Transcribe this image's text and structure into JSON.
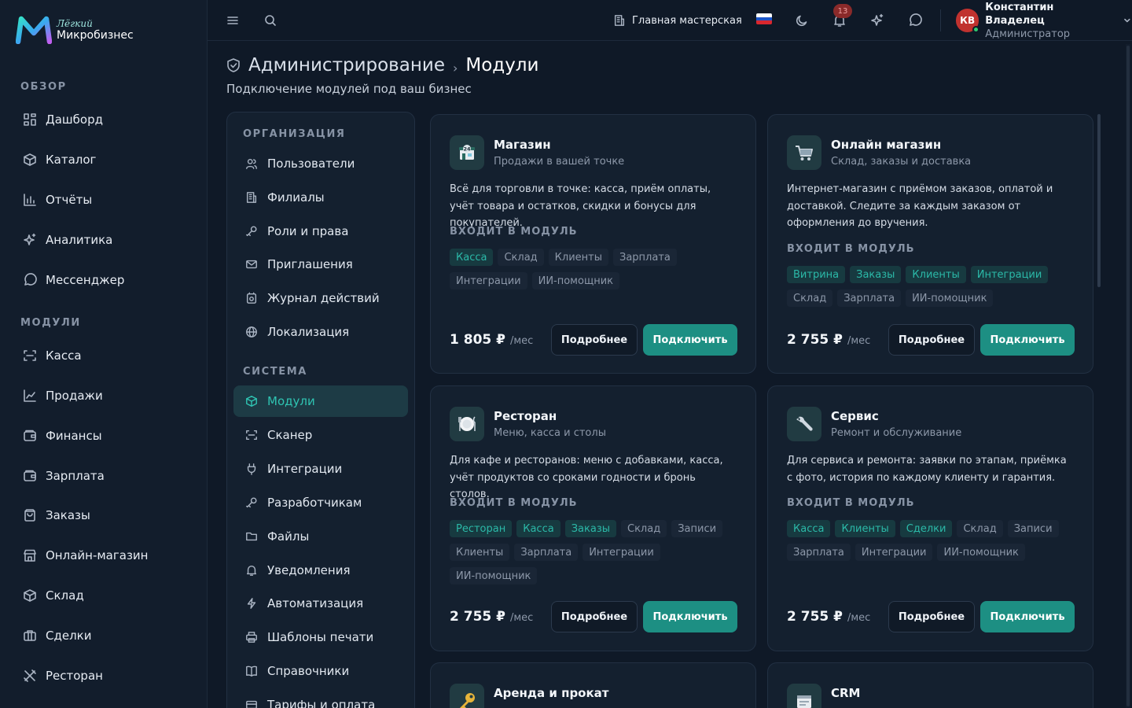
{
  "brand": {
    "top": "Лёгкий",
    "bottom": "Микробизнес"
  },
  "sidebar": {
    "overview_title": "ОБЗОР",
    "overview": [
      {
        "label": "Дашборд",
        "icon": "dashboard-icon"
      },
      {
        "label": "Каталог",
        "icon": "catalog-icon"
      },
      {
        "label": "Отчёты",
        "icon": "reports-icon"
      },
      {
        "label": "Аналитика",
        "icon": "analytics-icon"
      },
      {
        "label": "Мессенджер",
        "icon": "messenger-icon"
      }
    ],
    "modules_title": "МОДУЛИ",
    "modules": [
      {
        "label": "Касса",
        "icon": "scan-icon"
      },
      {
        "label": "Продажи",
        "icon": "chart-line-icon"
      },
      {
        "label": "Финансы",
        "icon": "wallet-icon"
      },
      {
        "label": "Зарплата",
        "icon": "wallet-icon"
      },
      {
        "label": "Заказы",
        "icon": "bag-icon"
      },
      {
        "label": "Онлайн-магазин",
        "icon": "store-icon"
      },
      {
        "label": "Склад",
        "icon": "box-icon"
      },
      {
        "label": "Сделки",
        "icon": "briefcase-icon"
      },
      {
        "label": "Ресторан",
        "icon": "utensils-icon"
      }
    ]
  },
  "topbar": {
    "workshop": "Главная мастерская",
    "notifications_count": "13",
    "user_initials": "КВ",
    "user_name": "Константин Владелец",
    "user_role": "Администратор"
  },
  "page": {
    "breadcrumb": "Администрирование",
    "breadcrumb_sep": "›",
    "title": "Модули",
    "subtitle": "Подключение модулей под ваш бизнес"
  },
  "settings": {
    "org_title": "ОРГАНИЗАЦИЯ",
    "org": [
      {
        "label": "Пользователи",
        "icon": "users-icon"
      },
      {
        "label": "Филиалы",
        "icon": "building-icon"
      },
      {
        "label": "Роли и права",
        "icon": "key-icon"
      },
      {
        "label": "Приглашения",
        "icon": "mail-icon"
      },
      {
        "label": "Журнал действий",
        "icon": "history-icon"
      },
      {
        "label": "Локализация",
        "icon": "globe-icon"
      }
    ],
    "sys_title": "СИСТЕМА",
    "sys": [
      {
        "label": "Модули",
        "icon": "cube-icon",
        "active": true
      },
      {
        "label": "Сканер",
        "icon": "scan-icon"
      },
      {
        "label": "Интеграции",
        "icon": "plug-icon"
      },
      {
        "label": "Разработчикам",
        "icon": "key-icon"
      },
      {
        "label": "Файлы",
        "icon": "folder-icon"
      },
      {
        "label": "Уведомления",
        "icon": "bell-icon"
      },
      {
        "label": "Автоматизация",
        "icon": "bolt-icon"
      },
      {
        "label": "Шаблоны печати",
        "icon": "printer-icon"
      },
      {
        "label": "Справочники",
        "icon": "book-icon"
      },
      {
        "label": "Тарифы и оплата",
        "icon": "card-icon"
      }
    ]
  },
  "modules": {
    "included_label": "ВХОДИТ В МОДУЛЬ",
    "per": "/мес",
    "more_label": "Подробнее",
    "connect_label": "Подключить",
    "cards": [
      {
        "title": "Магазин",
        "subtitle": "Продажи в вашей точке",
        "icon": "shop-icon",
        "description": "Всё для торговли в точке: касса, приём оплаты, учёт товара и остатков, скидки и бонусы для покупателей.",
        "tags": [
          {
            "label": "Касса",
            "on": true
          },
          {
            "label": "Склад",
            "on": false
          },
          {
            "label": "Клиенты",
            "on": false
          },
          {
            "label": "Зарплата",
            "on": false
          },
          {
            "label": "Интеграции",
            "on": false
          },
          {
            "label": "ИИ-помощник",
            "on": false
          }
        ],
        "price": "1 805 ₽"
      },
      {
        "title": "Онлайн магазин",
        "subtitle": "Склад, заказы и доставка",
        "icon": "cart-icon",
        "description": "Интернет-магазин с приёмом заказов, оплатой и доставкой. Следите за каждым заказом от оформления до вручения.",
        "tags": [
          {
            "label": "Витрина",
            "on": true
          },
          {
            "label": "Заказы",
            "on": true
          },
          {
            "label": "Клиенты",
            "on": true
          },
          {
            "label": "Интеграции",
            "on": true
          },
          {
            "label": "Склад",
            "on": false
          },
          {
            "label": "Зарплата",
            "on": false
          },
          {
            "label": "ИИ-помощник",
            "on": false
          }
        ],
        "price": "2 755 ₽"
      },
      {
        "title": "Ресторан",
        "subtitle": "Меню, касса и столы",
        "icon": "plate-icon",
        "description": "Для кафе и ресторанов: меню с добавками, касса, учёт продуктов со сроками годности и бронь столов.",
        "tags": [
          {
            "label": "Ресторан",
            "on": true
          },
          {
            "label": "Касса",
            "on": true
          },
          {
            "label": "Заказы",
            "on": true
          },
          {
            "label": "Склад",
            "on": false
          },
          {
            "label": "Записи",
            "on": false
          },
          {
            "label": "Клиенты",
            "on": false
          },
          {
            "label": "Зарплата",
            "on": false
          },
          {
            "label": "Интеграции",
            "on": false
          },
          {
            "label": "ИИ-помощник",
            "on": false
          }
        ],
        "price": "2 755 ₽"
      },
      {
        "title": "Сервис",
        "subtitle": "Ремонт и обслуживание",
        "icon": "wrench-icon",
        "description": "Для сервиса и ремонта: заявки по этапам, приёмка с фото, история по каждому клиенту и гарантия.",
        "tags": [
          {
            "label": "Касса",
            "on": true
          },
          {
            "label": "Клиенты",
            "on": true
          },
          {
            "label": "Сделки",
            "on": true
          },
          {
            "label": "Склад",
            "on": false
          },
          {
            "label": "Записи",
            "on": false
          },
          {
            "label": "Зарплата",
            "on": false
          },
          {
            "label": "Интеграции",
            "on": false
          },
          {
            "label": "ИИ-помощник",
            "on": false
          }
        ],
        "price": "2 755 ₽"
      },
      {
        "title": "Аренда и прокат",
        "subtitle": "",
        "icon": "key-gold-icon",
        "description": "",
        "tags": [],
        "price": ""
      },
      {
        "title": "CRM",
        "subtitle": "",
        "icon": "crm-icon",
        "description": "",
        "tags": [],
        "price": ""
      }
    ]
  },
  "colors": {
    "accent": "#1d8f83",
    "accent_text": "#2bb9a8",
    "bg": "#0f1927",
    "panel": "#14202f"
  }
}
